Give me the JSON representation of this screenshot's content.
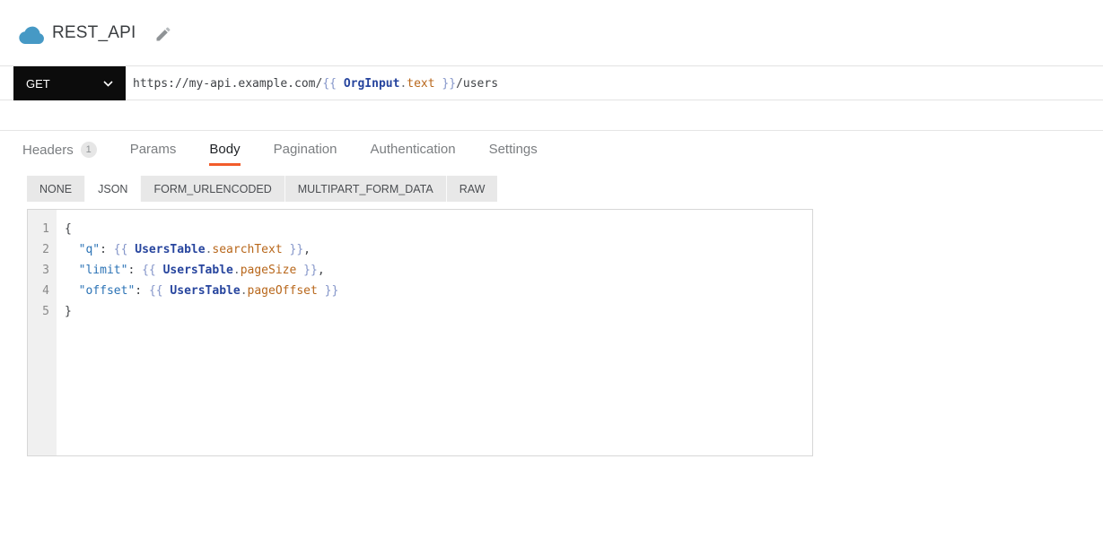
{
  "header": {
    "title": "REST_API",
    "logo_icon": "cloud-icon",
    "edit_icon": "pencil-icon"
  },
  "request_bar": {
    "method": "GET",
    "url": {
      "base": "https://my-api.example.com/",
      "brace_open": "{{ ",
      "variable": "OrgInput",
      "dot": ".",
      "property": "text",
      "brace_close": " }}",
      "suffix": "/users"
    }
  },
  "tabs": [
    {
      "label": "Headers",
      "badge": "1",
      "active": false
    },
    {
      "label": "Params",
      "active": false
    },
    {
      "label": "Body",
      "active": true
    },
    {
      "label": "Pagination",
      "active": false
    },
    {
      "label": "Authentication",
      "active": false
    },
    {
      "label": "Settings",
      "active": false
    }
  ],
  "body_type_tabs": [
    {
      "label": "NONE",
      "active": false
    },
    {
      "label": "JSON",
      "active": true
    },
    {
      "label": "FORM_URLENCODED",
      "active": false
    },
    {
      "label": "MULTIPART_FORM_DATA",
      "active": false
    },
    {
      "label": "RAW",
      "active": false
    }
  ],
  "editor": {
    "lines": [
      {
        "n": "1",
        "code": [
          {
            "t": "{"
          }
        ]
      },
      {
        "n": "2",
        "code": [
          {
            "t": "  "
          },
          {
            "t": "\"q\""
          },
          {
            "t": ": "
          },
          {
            "t": "{{ "
          },
          {
            "t": "UsersTable"
          },
          {
            "t": "."
          },
          {
            "t": "searchText"
          },
          {
            "t": " }}"
          },
          {
            "t": ","
          }
        ]
      },
      {
        "n": "3",
        "code": [
          {
            "t": "  "
          },
          {
            "t": "\"limit\""
          },
          {
            "t": ": "
          },
          {
            "t": "{{ "
          },
          {
            "t": "UsersTable"
          },
          {
            "t": "."
          },
          {
            "t": "pageSize"
          },
          {
            "t": " }}"
          },
          {
            "t": ","
          }
        ]
      },
      {
        "n": "4",
        "code": [
          {
            "t": "  "
          },
          {
            "t": "\"offset\""
          },
          {
            "t": ": "
          },
          {
            "t": "{{ "
          },
          {
            "t": "UsersTable"
          },
          {
            "t": "."
          },
          {
            "t": "pageOffset"
          },
          {
            "t": " }}"
          }
        ]
      },
      {
        "n": "5",
        "code": [
          {
            "t": "}"
          }
        ]
      }
    ]
  },
  "colors": {
    "accent_orange": "#f25c2b",
    "method_dropdown_bg": "#0c0c0c",
    "logo_blue": "#4699c5",
    "json_key": "#2a72b5",
    "template_brace": "#8495c9",
    "template_variable": "#27459e",
    "template_property": "#b8671b",
    "subtab_bg": "#e8e8e8",
    "gutter_bg": "#f0f0f0"
  }
}
